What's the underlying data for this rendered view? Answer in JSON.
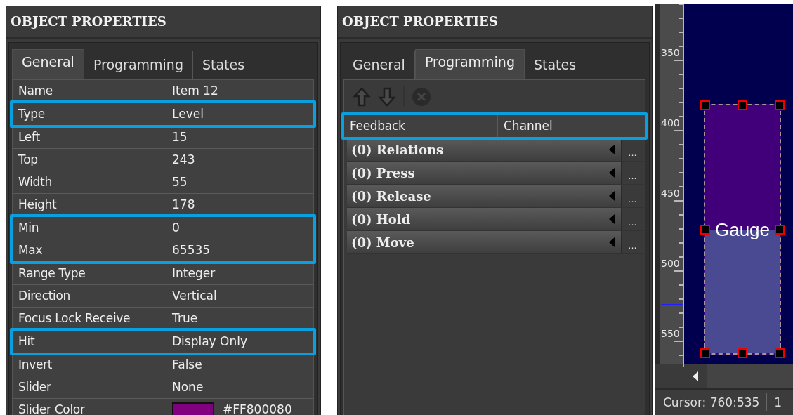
{
  "panels": [
    {
      "title": "OBJECT PROPERTIES",
      "tabs": [
        {
          "label": "General",
          "selected": true
        },
        {
          "label": "Programming",
          "selected": false
        },
        {
          "label": "States",
          "selected": false
        }
      ],
      "properties": [
        {
          "name": "Name",
          "value": "Item 12",
          "highlighted": false
        },
        {
          "name": "Type",
          "value": "Level",
          "highlighted": true
        },
        {
          "name": "Left",
          "value": "15",
          "highlighted": false
        },
        {
          "name": "Top",
          "value": "243",
          "highlighted": false
        },
        {
          "name": "Width",
          "value": "55",
          "highlighted": false
        },
        {
          "name": "Height",
          "value": "178",
          "highlighted": false
        },
        {
          "name": "Min",
          "value": "0",
          "highlighted": true
        },
        {
          "name": "Max",
          "value": "65535",
          "highlighted": true
        },
        {
          "name": "Range Type",
          "value": "Integer",
          "highlighted": false
        },
        {
          "name": "Direction",
          "value": "Vertical",
          "highlighted": false
        },
        {
          "name": "Focus Lock Receive",
          "value": "True",
          "highlighted": false
        },
        {
          "name": "Hit",
          "value": "Display Only",
          "highlighted": true
        },
        {
          "name": "Invert",
          "value": "False",
          "highlighted": false
        },
        {
          "name": "Slider",
          "value": "None",
          "highlighted": false
        },
        {
          "name": "Slider Color",
          "value": "#FF800080",
          "highlighted": false,
          "color": "#800080"
        }
      ]
    },
    {
      "title": "OBJECT PROPERTIES",
      "tabs": [
        {
          "label": "General",
          "selected": false
        },
        {
          "label": "Programming",
          "selected": true
        },
        {
          "label": "States",
          "selected": false
        }
      ],
      "toolbar": true,
      "properties": [
        {
          "name": "Feedback",
          "value": "Channel",
          "highlighted": true
        }
      ],
      "events": [
        {
          "label": "(0) Relations",
          "button": "..."
        },
        {
          "label": "(0) Press",
          "button": "..."
        },
        {
          "label": "(0) Release",
          "button": "..."
        },
        {
          "label": "(0) Hold",
          "button": "..."
        },
        {
          "label": "(0) Move",
          "button": "..."
        }
      ]
    }
  ],
  "designer": {
    "ruler_labels": [
      "350",
      "400",
      "450",
      "500",
      "550"
    ],
    "object": {
      "label": "Gauge",
      "level": 0.5,
      "selected": true
    },
    "status_bar": [
      "Cursor: 760:535",
      "1"
    ]
  }
}
